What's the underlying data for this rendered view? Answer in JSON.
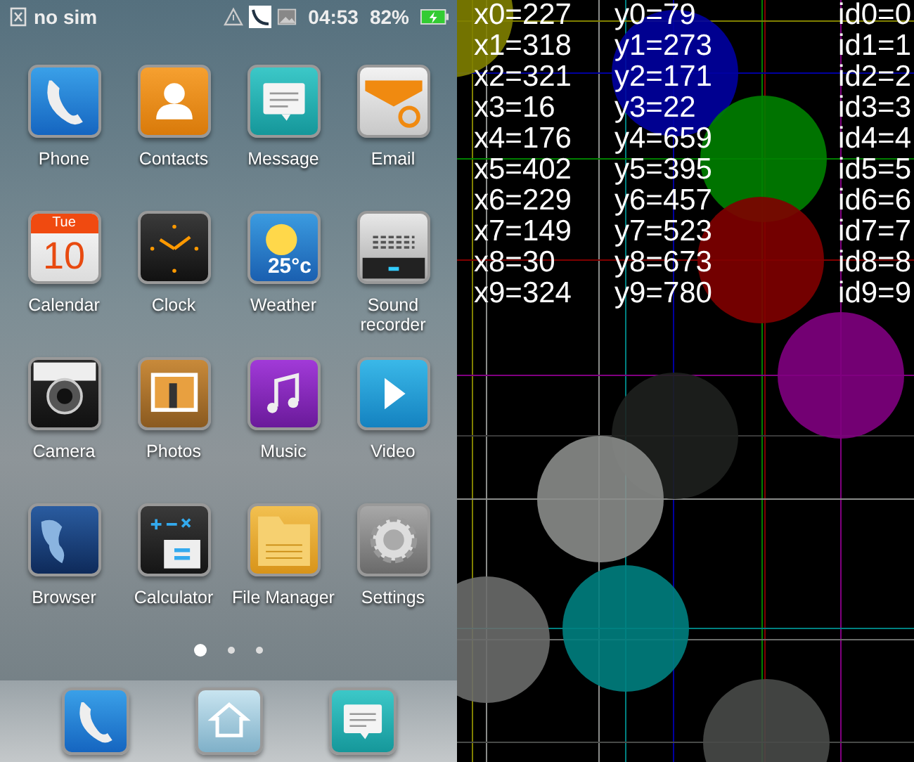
{
  "status_bar": {
    "carrier": "no sim",
    "time": "04:53",
    "battery": "82%"
  },
  "apps": [
    {
      "kind": "phone",
      "label": "Phone"
    },
    {
      "kind": "contacts",
      "label": "Contacts"
    },
    {
      "kind": "message",
      "label": "Message"
    },
    {
      "kind": "email",
      "label": "Email"
    },
    {
      "kind": "calendar",
      "label": "Calendar",
      "day": "Tue",
      "date": "10"
    },
    {
      "kind": "clock",
      "label": "Clock"
    },
    {
      "kind": "weather",
      "label": "Weather",
      "temperature": "25°c"
    },
    {
      "kind": "recorder",
      "label": "Sound recorder"
    },
    {
      "kind": "camera",
      "label": "Camera"
    },
    {
      "kind": "photos",
      "label": "Photos"
    },
    {
      "kind": "music",
      "label": "Music"
    },
    {
      "kind": "video",
      "label": "Video"
    },
    {
      "kind": "browser",
      "label": "Browser"
    },
    {
      "kind": "calculator",
      "label": "Calculator"
    },
    {
      "kind": "files",
      "label": "File Manager"
    },
    {
      "kind": "settings",
      "label": "Settings"
    }
  ],
  "page_dots": [
    {
      "selected": true
    },
    {
      "selected": false
    },
    {
      "selected": false
    }
  ],
  "dock": [
    {
      "kind": "phone"
    },
    {
      "kind": "home"
    },
    {
      "kind": "message"
    }
  ],
  "touch_readout": [
    {
      "x": "x0=227",
      "y": "y0=79",
      "id": "id0=0"
    },
    {
      "x": "x1=318",
      "y": "y1=273",
      "id": "id1=1"
    },
    {
      "x": "x2=321",
      "y": "y2=171",
      "id": "id2=2"
    },
    {
      "x": "x3=16",
      "y": "y3=22",
      "id": "id3=3"
    },
    {
      "x": "x4=176",
      "y": "y4=659",
      "id": "id4=4"
    },
    {
      "x": "x5=402",
      "y": "y5=395",
      "id": "id5=5"
    },
    {
      "x": "x6=229",
      "y": "y6=457",
      "id": "id6=6"
    },
    {
      "x": "x7=149",
      "y": "y7=523",
      "id": "id7=7"
    },
    {
      "x": "x8=30",
      "y": "y8=673",
      "id": "id8=8"
    },
    {
      "x": "x9=324",
      "y": "y9=780",
      "id": "id9=9"
    }
  ]
}
